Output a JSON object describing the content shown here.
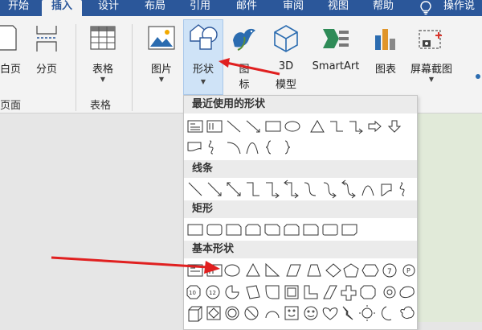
{
  "tabs": [
    {
      "label": "开始",
      "active": false
    },
    {
      "label": "插入",
      "active": true
    },
    {
      "label": "设计",
      "active": false
    },
    {
      "label": "布局",
      "active": false
    },
    {
      "label": "引用",
      "active": false
    },
    {
      "label": "邮件",
      "active": false
    },
    {
      "label": "审阅",
      "active": false
    },
    {
      "label": "视图",
      "active": false
    },
    {
      "label": "帮助",
      "active": false
    },
    {
      "label": "操作说",
      "active": false
    }
  ],
  "ribbon": {
    "blank_page": "白页",
    "page_break": "分页",
    "pages_group": "页面",
    "table": "表格",
    "tables_group": "表格",
    "picture": "图片",
    "shapes": "形状",
    "icons_line1": "图",
    "icons_line2": "标",
    "model_line1": "3D",
    "model_line2": "模型",
    "smartart": "SmartArt",
    "chart": "图表",
    "screenshot": "屏幕截图"
  },
  "dropdown": {
    "recent_header": "最近使用的形状",
    "lines_header": "线条",
    "rect_header": "矩形",
    "basic_header": "基本形状"
  },
  "icons": {
    "lightbulb": "lightbulb-icon",
    "table": "table-grid-icon",
    "picture": "picture-icon",
    "shapes": "shapes-icon",
    "icons": "icons-bird-icon",
    "model": "cube-3d-icon",
    "smartart": "smartart-icon",
    "chart": "bar-chart-icon",
    "screenshot": "screenshot-icon"
  },
  "colors": {
    "ribbon_blue": "#2b579a",
    "annotation_red": "#e02020",
    "selected_highlight": "#cfe3f7"
  }
}
